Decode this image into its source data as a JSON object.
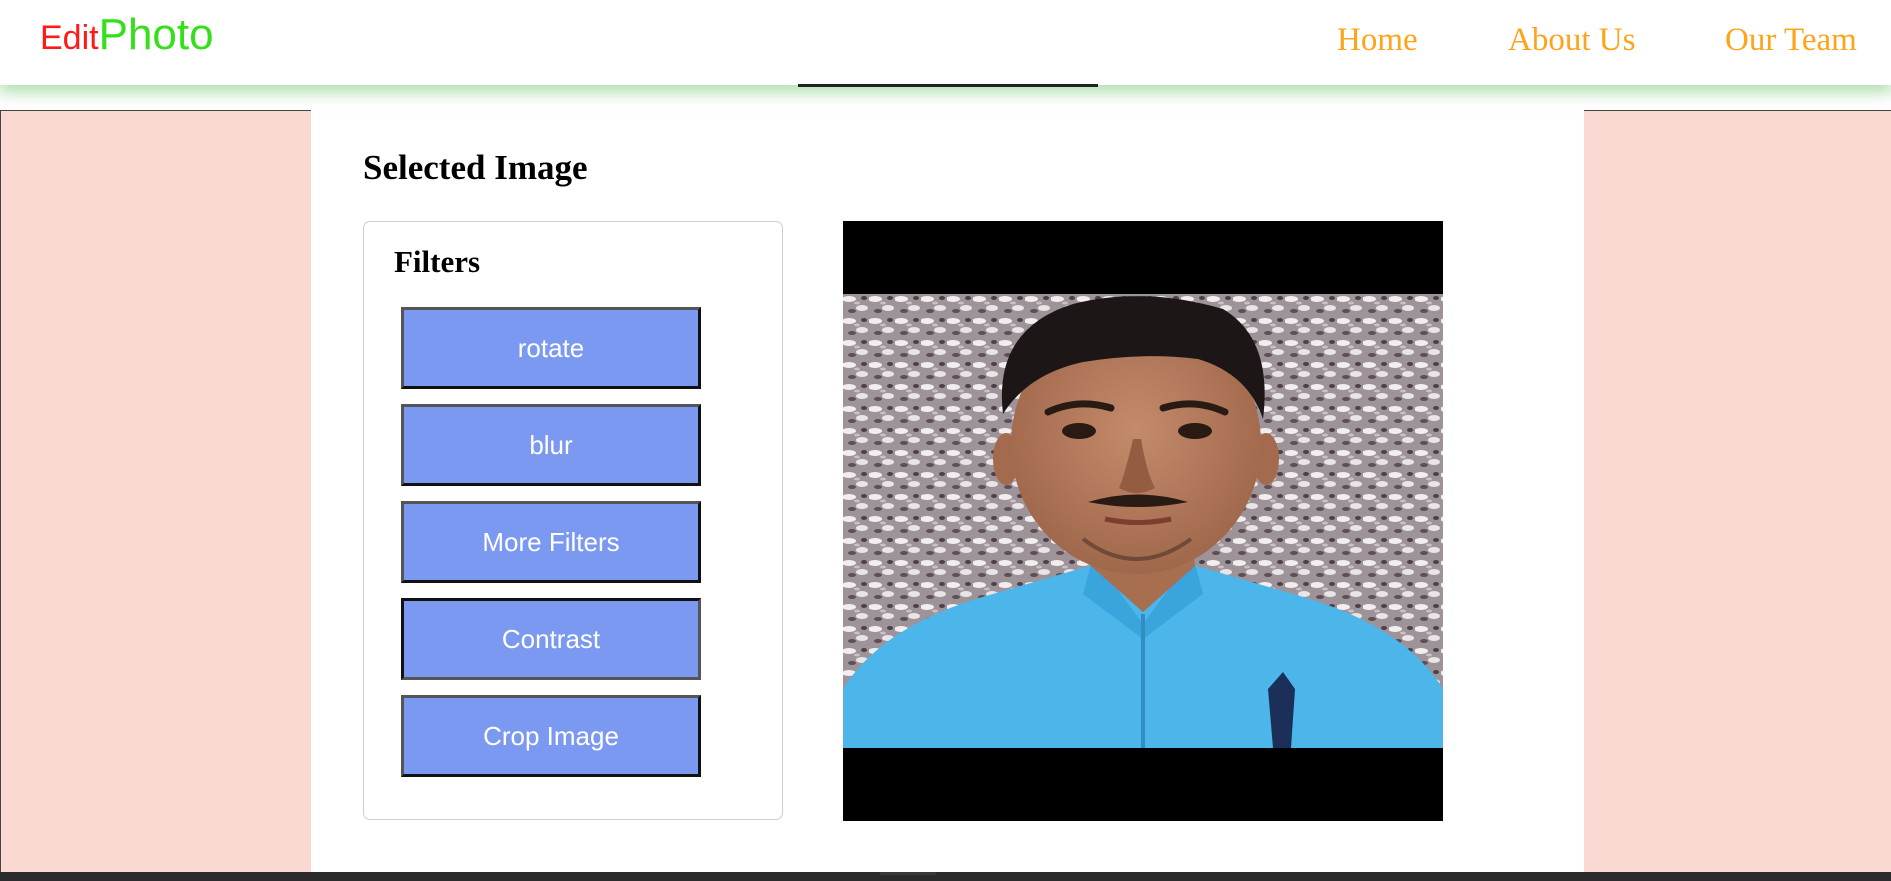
{
  "brand": {
    "edit": "Edit",
    "photo": "Photo",
    "edit_color": "#ff1a1a",
    "photo_color": "#33e01a"
  },
  "nav": {
    "home": "Home",
    "about": "About Us",
    "team": "Our Team",
    "link_color": "#ffa31a"
  },
  "main": {
    "title": "Selected Image",
    "filters": {
      "title": "Filters",
      "buttons": [
        "rotate",
        "blur",
        "More Filters",
        "Contrast",
        "Crop Image"
      ],
      "button_color": "#7c99f2"
    }
  },
  "colors": {
    "page_background": "#f9d9d1",
    "header_shadow": "#9fd89f"
  }
}
